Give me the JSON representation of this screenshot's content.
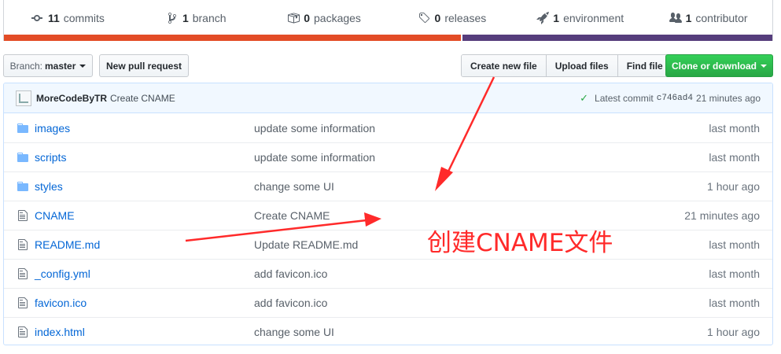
{
  "summary": {
    "commits": {
      "count": "11",
      "label": "commits"
    },
    "branches": {
      "count": "1",
      "label": "branch"
    },
    "packages": {
      "count": "0",
      "label": "packages"
    },
    "releases": {
      "count": "0",
      "label": "releases"
    },
    "environments": {
      "count": "1",
      "label": "environment"
    },
    "contributors": {
      "count": "1",
      "label": "contributor"
    },
    "languages": [
      {
        "color": "#e34c26",
        "fraction": 0.596
      },
      {
        "color": "#563d7c",
        "fraction": 0.404
      }
    ]
  },
  "toolbar": {
    "branch_prefix": "Branch:",
    "branch_name": "master",
    "new_pull_request": "New pull request",
    "create_new_file": "Create new file",
    "upload_files": "Upload files",
    "find_file": "Find file",
    "clone_or_download": "Clone or download"
  },
  "latest_commit": {
    "author": "MoreCodeByTR",
    "message": "Create CNAME",
    "label": "Latest commit",
    "sha": "c746ad4",
    "time": "21 minutes ago"
  },
  "files": [
    {
      "type": "dir",
      "name": "images",
      "message": "update some information",
      "age": "last month"
    },
    {
      "type": "dir",
      "name": "scripts",
      "message": "update some information",
      "age": "last month"
    },
    {
      "type": "dir",
      "name": "styles",
      "message": "change some UI",
      "age": "1 hour ago"
    },
    {
      "type": "file",
      "name": "CNAME",
      "message": "Create CNAME",
      "age": "21 minutes ago"
    },
    {
      "type": "file",
      "name": "README.md",
      "message": "Update README.md",
      "age": "last month"
    },
    {
      "type": "file",
      "name": "_config.yml",
      "message": "add favicon.ico",
      "age": "last month"
    },
    {
      "type": "file",
      "name": "favicon.ico",
      "message": "add favicon.ico",
      "age": "last month"
    },
    {
      "type": "file",
      "name": "index.html",
      "message": "change some UI",
      "age": "1 hour ago"
    }
  ],
  "annotation": {
    "text": "创建CNAME文件",
    "color": "#ff2a2a"
  }
}
